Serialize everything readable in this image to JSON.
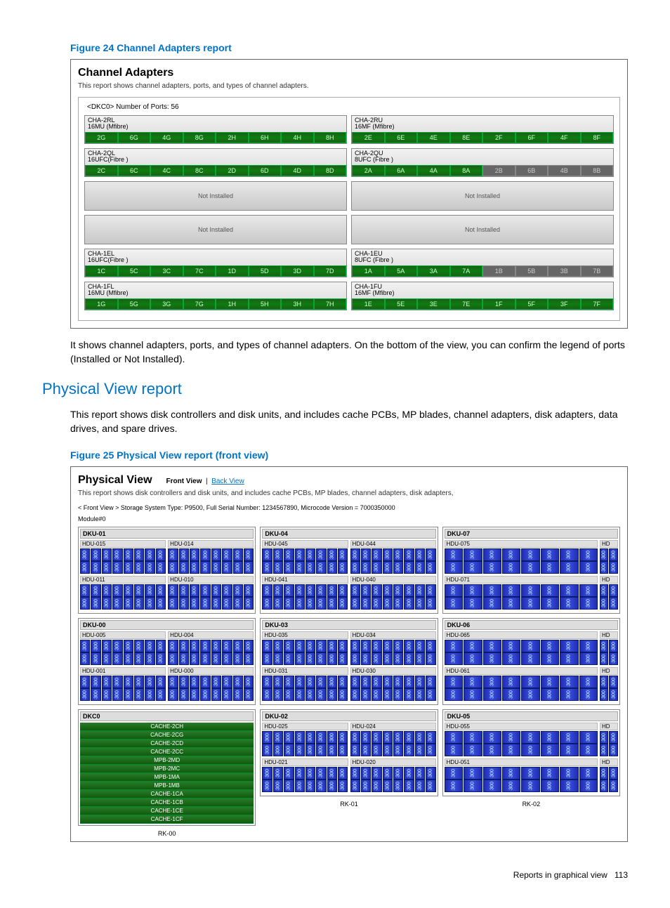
{
  "figure24": {
    "caption": "Figure 24 Channel Adapters report",
    "title": "Channel Adapters",
    "desc": "This report shows channel adapters, ports, and types of channel adapters.",
    "top_label": "<DKC0> Number of Ports: 56",
    "not_installed": "Not Installed",
    "left": [
      {
        "name": "CHA-2RL",
        "type": "16MU (Mfibre)",
        "ports": [
          "2G",
          "6G",
          "4G",
          "8G",
          "2H",
          "6H",
          "4H",
          "8H"
        ],
        "disabled": false
      },
      {
        "name": "CHA-2QL",
        "type": "16UFC(Fibre )",
        "ports": [
          "2C",
          "6C",
          "4C",
          "8C",
          "2D",
          "6D",
          "4D",
          "8D"
        ],
        "disabled": false
      },
      {
        "empty": true
      },
      {
        "empty": true
      },
      {
        "name": "CHA-1EL",
        "type": "16UFC(Fibre )",
        "ports": [
          "1C",
          "5C",
          "3C",
          "7C",
          "1D",
          "5D",
          "3D",
          "7D"
        ],
        "disabled": false
      },
      {
        "name": "CHA-1FL",
        "type": "16MU (Mfibre)",
        "ports": [
          "1G",
          "5G",
          "3G",
          "7G",
          "1H",
          "5H",
          "3H",
          "7H"
        ],
        "disabled": false
      }
    ],
    "right": [
      {
        "name": "CHA-2RU",
        "type": "16MF (Mfibre)",
        "ports": [
          "2E",
          "6E",
          "4E",
          "8E",
          "2F",
          "6F",
          "4F",
          "8F"
        ],
        "disabled": false
      },
      {
        "name": "CHA-2QU",
        "type": "8UFC (Fibre )",
        "ports": [
          "2A",
          "6A",
          "4A",
          "8A",
          "2B",
          "6B",
          "4B",
          "8B"
        ],
        "half_disabled": true
      },
      {
        "empty": true
      },
      {
        "empty": true
      },
      {
        "name": "CHA-1EU",
        "type": "8UFC (Fibre )",
        "ports": [
          "1A",
          "5A",
          "3A",
          "7A",
          "1B",
          "5B",
          "3B",
          "7B"
        ],
        "half_disabled": true
      },
      {
        "name": "CHA-1FU",
        "type": "16MF (Mfibre)",
        "ports": [
          "1E",
          "5E",
          "3E",
          "7E",
          "1F",
          "5F",
          "3F",
          "7F"
        ],
        "disabled": false
      }
    ]
  },
  "para1": "It shows channel adapters, ports, and types of channel adapters. On the bottom of the view, you can confirm the legend of ports (Installed or Not Installed).",
  "section2_title": "Physical View report",
  "para2": "This report shows disk controllers and disk units, and includes cache PCBs, MP blades, channel adapters, disk adapters, data drives, and spare drives.",
  "figure25": {
    "caption": "Figure 25 Physical View report (front view)",
    "title": "Physical View",
    "front_link": "Front View",
    "back_link": "Back View",
    "desc": "This report shows disk controllers and disk units, and includes cache PCBs, MP blades, channel adapters, disk adapters,",
    "meta": "< Front View > Storage System Type: P9500, Full Serial Number: 1234567890, Microcode Version = 7000350000",
    "module": "Module#0",
    "dkc_title": "DKC0",
    "dkc_items": [
      "CACHE-2CH",
      "CACHE-2CG",
      "CACHE-2CD",
      "CACHE-2CC",
      "MPB-2MD",
      "MPB-2MC",
      "MPB-1MA",
      "MPB-1MB",
      "CACHE-1CA",
      "CACHE-1CB",
      "CACHE-1CE",
      "CACHE-1CF"
    ],
    "rk": [
      "RK-00",
      "RK-01",
      "RK-02"
    ],
    "cols": [
      {
        "rk": "RK-00",
        "dku": [
          {
            "name": "DKU-01",
            "hdu": [
              {
                "left": "HDU-015",
                "right": "HDU-014"
              },
              {
                "left": "HDU-011",
                "right": "HDU-010"
              }
            ]
          },
          {
            "name": "DKU-00",
            "hdu": [
              {
                "left": "HDU-005",
                "right": "HDU-004"
              },
              {
                "left": "HDU-001",
                "right": "HDU-000"
              }
            ]
          }
        ]
      },
      {
        "rk": "RK-01",
        "dku": [
          {
            "name": "DKU-04",
            "hdu": [
              {
                "left": "HDU-045",
                "right": "HDU-044"
              },
              {
                "left": "HDU-041",
                "right": "HDU-040"
              }
            ]
          },
          {
            "name": "DKU-03",
            "hdu": [
              {
                "left": "HDU-035",
                "right": "HDU-034"
              },
              {
                "left": "HDU-031",
                "right": "HDU-030"
              }
            ]
          },
          {
            "name": "DKU-02",
            "hdu": [
              {
                "left": "HDU-025",
                "right": "HDU-024"
              },
              {
                "left": "HDU-021",
                "right": "HDU-020"
              }
            ]
          }
        ]
      },
      {
        "rk": "RK-02",
        "dku": [
          {
            "name": "DKU-07",
            "hdu": [
              {
                "left": "HDU-075",
                "right": "HD"
              },
              {
                "left": "HDU-071",
                "right": "HD"
              }
            ]
          },
          {
            "name": "DKU-06",
            "hdu": [
              {
                "left": "HDU-065",
                "right": "HD"
              },
              {
                "left": "HDU-061",
                "right": "HD"
              }
            ]
          },
          {
            "name": "DKU-05",
            "hdu": [
              {
                "left": "HDU-055",
                "right": "HD"
              },
              {
                "left": "HDU-051",
                "right": "HD"
              }
            ]
          }
        ]
      }
    ]
  },
  "footer_text": "Reports in graphical view",
  "footer_page": "113"
}
